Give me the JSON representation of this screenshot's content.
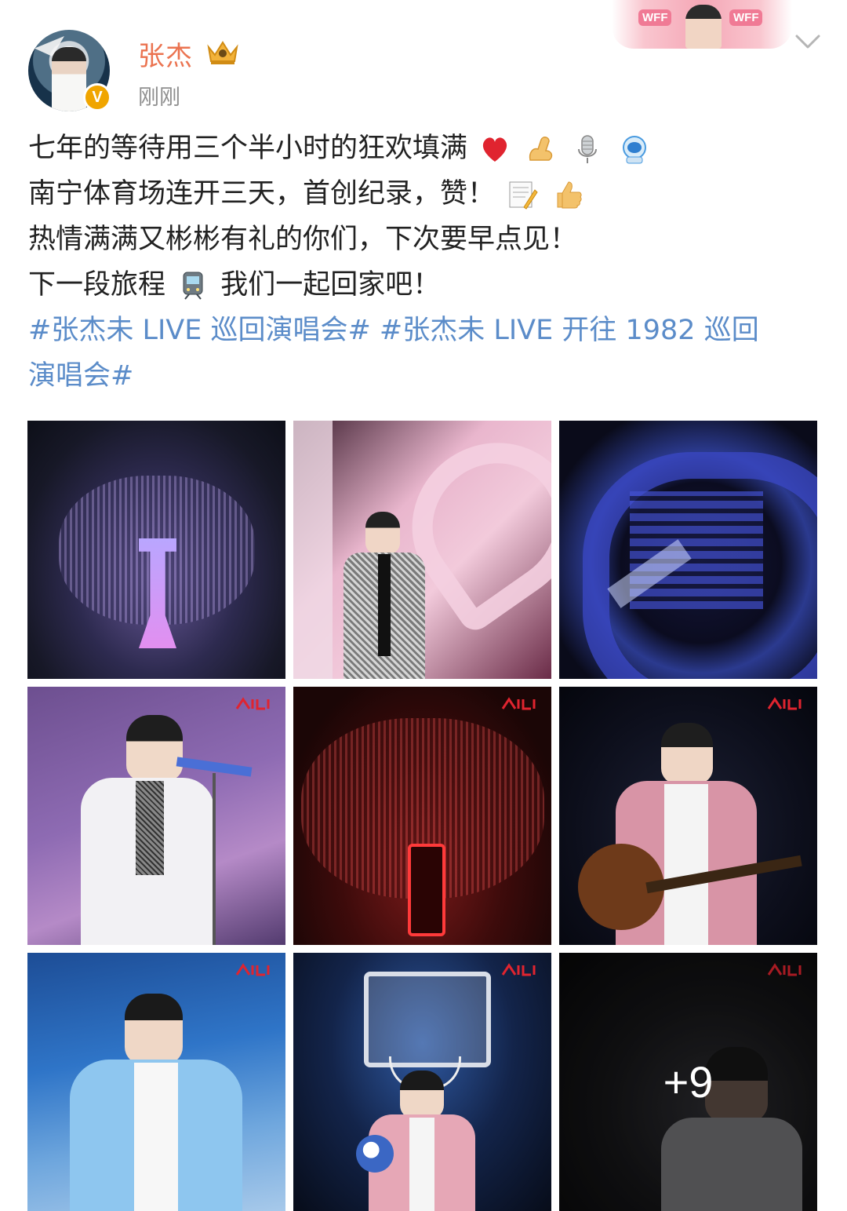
{
  "header": {
    "username": "张杰",
    "timestamp": "刚刚",
    "avatar_icon": "avatar-icon",
    "verified_icon": "verified-v-icon",
    "crown_icon": "crown-icon",
    "banner_tag": "WFF",
    "more_icon": "chevron-down-icon",
    "colors": {
      "username": "#eb7350",
      "timestamp": "#8f8f8f",
      "link": "#5b8cc9"
    }
  },
  "post": {
    "lines": [
      "七年的等待用三个半小时的狂欢填满",
      "南宁体育场连开三天，首创纪录，赞！",
      "热情满满又彬彬有礼的你们，下次要早点见！",
      "下一段旅程",
      "我们一起回家吧！"
    ],
    "emoji": [
      "heart-emoji",
      "muscle-emoji",
      "microphone-emoji",
      "astronaut-emoji",
      "memo-emoji",
      "thumbs-up-emoji",
      "train-emoji"
    ],
    "hashtag_line1": "#张杰未 LIVE 巡回演唱会# #张杰未 LIVE 开往 1982 巡回",
    "hashtag_line2": "演唱会#"
  },
  "gallery": {
    "images": [
      "stadium-overhead-photo",
      "singer-heart-stage-photo",
      "stadium-blue-aerial-photo",
      "singer-white-shirt-mic-photo",
      "stadium-red-stage-photo",
      "singer-guitar-pink-jacket-photo",
      "singer-blue-jacket-photo",
      "singer-basketball-hoop-photo",
      "singer-dark-silhouette-photo"
    ],
    "more_count": "+9"
  }
}
